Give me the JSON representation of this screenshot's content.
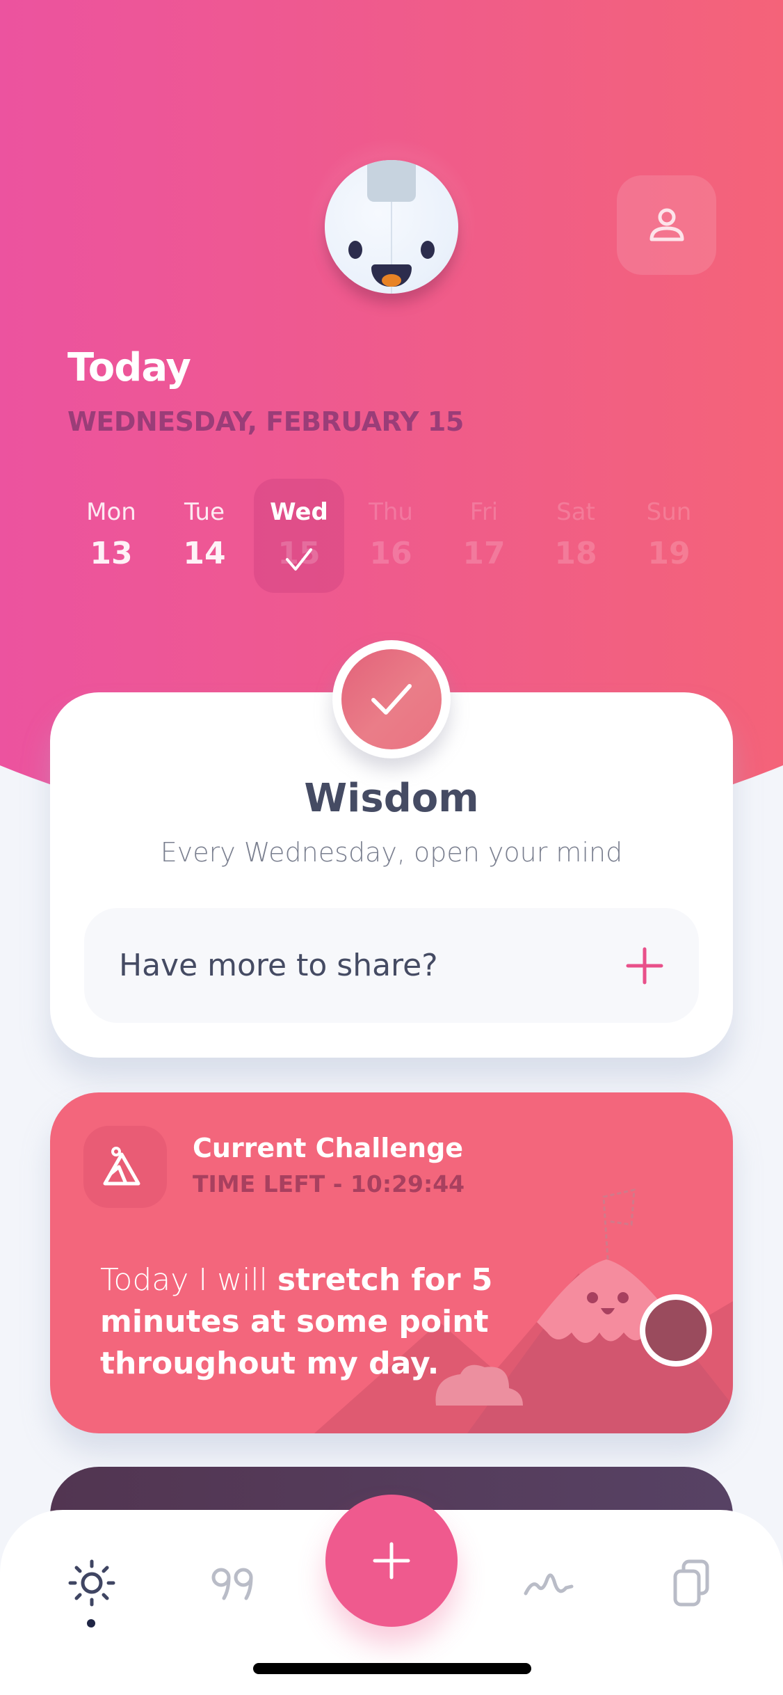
{
  "header": {
    "title": "Today",
    "date": "WEDNESDAY, FEBRUARY 15",
    "profile_icon": "user-icon"
  },
  "week": {
    "days": [
      {
        "name": "Mon",
        "num": "13",
        "state": "past"
      },
      {
        "name": "Tue",
        "num": "14",
        "state": "past"
      },
      {
        "name": "Wed",
        "num": "15",
        "state": "today-completed"
      },
      {
        "name": "Thu",
        "num": "16",
        "state": "future"
      },
      {
        "name": "Fri",
        "num": "17",
        "state": "future"
      },
      {
        "name": "Sat",
        "num": "18",
        "state": "future"
      },
      {
        "name": "Sun",
        "num": "19",
        "state": "future"
      }
    ]
  },
  "wisdom": {
    "title": "Wisdom",
    "subtitle": "Every Wednesday, open your mind",
    "share_placeholder": "Have more to share?",
    "completed": true
  },
  "challenge": {
    "title": "Current Challenge",
    "time_left": "TIME LEFT - 10:29:44",
    "text_prefix": "Today I will ",
    "text_bold": "stretch for 5 minutes at some point throughout my day."
  },
  "tabbar": {
    "tabs": [
      {
        "name": "today",
        "icon": "sun-icon",
        "active": true
      },
      {
        "name": "quotes",
        "icon": "quote-icon",
        "active": false
      },
      {
        "name": "add",
        "icon": "plus-icon",
        "active": false
      },
      {
        "name": "mood",
        "icon": "wave-icon",
        "active": false
      },
      {
        "name": "entries",
        "icon": "cards-icon",
        "active": false
      }
    ]
  },
  "colors": {
    "accent": "#ef5a8e",
    "challenge": "#f3667c",
    "text_dark": "#454b63"
  }
}
